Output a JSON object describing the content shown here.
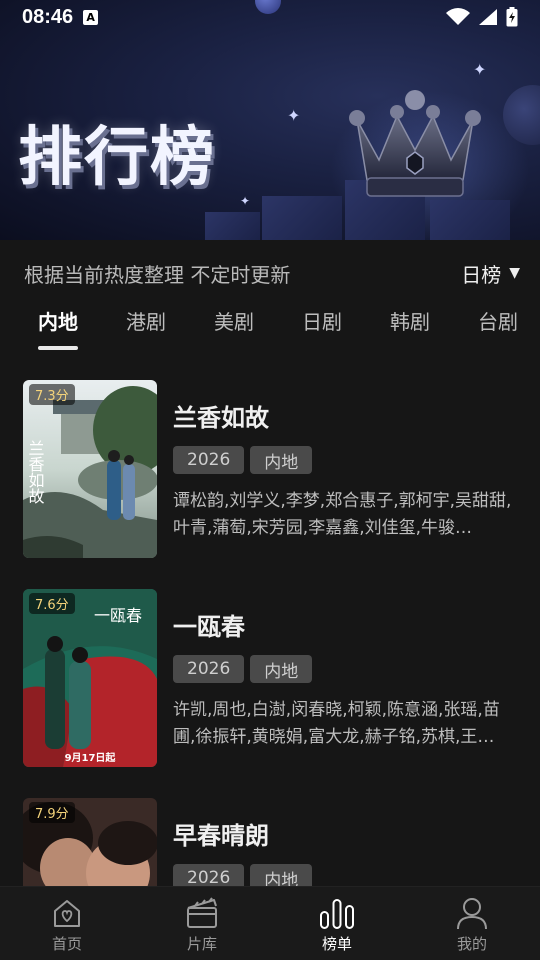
{
  "status_bar": {
    "time": "08:46",
    "badge": "A"
  },
  "hero": {
    "title": "排行榜"
  },
  "subhead": {
    "description": "根据当前热度整理 不定时更新",
    "period": "日榜"
  },
  "tabs": [
    {
      "label": "内地",
      "active": true
    },
    {
      "label": "港剧",
      "active": false
    },
    {
      "label": "美剧",
      "active": false
    },
    {
      "label": "日剧",
      "active": false
    },
    {
      "label": "韩剧",
      "active": false
    },
    {
      "label": "台剧",
      "active": false
    }
  ],
  "items": [
    {
      "score": "7.3分",
      "title": "兰香如故",
      "year": "2026",
      "region": "内地",
      "cast": "谭松韵,刘学义,李梦,郑合惠子,郭柯宇,吴甜甜,叶青,蒲萄,宋芳园,李嘉鑫,刘佳玺,牛骏…",
      "poster_text": "兰香如故"
    },
    {
      "score": "7.6分",
      "title": "一瓯春",
      "year": "2026",
      "region": "内地",
      "cast": "许凯,周也,白澍,闵春晓,柯颖,陈意涵,张瑶,苗圃,徐振轩,黄晓娟,富大龙,赫子铭,苏棋,王…",
      "poster_text": "一瓯春",
      "poster_date": "9月17日起"
    },
    {
      "score": "7.9分",
      "title": "早春晴朗",
      "year": "2026",
      "region": "内地",
      "cast": ""
    }
  ],
  "nav": [
    {
      "label": "首页",
      "icon": "home-icon",
      "active": false
    },
    {
      "label": "片库",
      "icon": "clapperboard-icon",
      "active": false
    },
    {
      "label": "榜单",
      "icon": "chart-bars-icon",
      "active": true
    },
    {
      "label": "我的",
      "icon": "user-icon",
      "active": false
    }
  ]
}
